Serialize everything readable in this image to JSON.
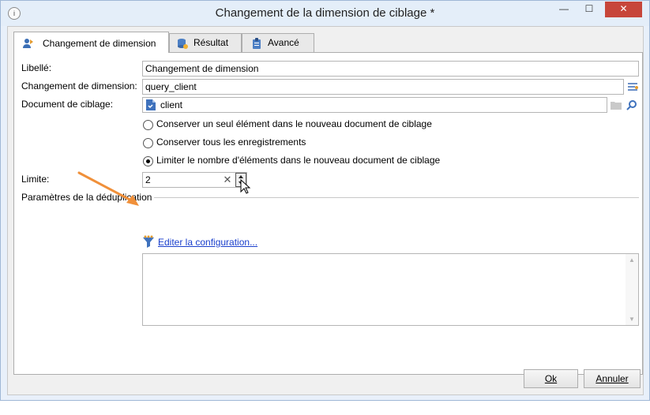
{
  "window": {
    "title": "Changement de la dimension de ciblage *",
    "app_icon": "i",
    "controls": {
      "minimize": "—",
      "maximize": "☐",
      "close": "✕"
    }
  },
  "tabs": [
    {
      "label": "Changement de dimension",
      "icon": "dimension-change-icon",
      "active": true
    },
    {
      "label": "Résultat",
      "icon": "result-icon",
      "active": false
    },
    {
      "label": "Avancé",
      "icon": "clipboard-icon",
      "active": false
    }
  ],
  "form": {
    "libelle_label": "Libellé:",
    "libelle_value": "Changement de dimension",
    "dimension_label": "Changement de dimension:",
    "dimension_value": "query_client",
    "document_label": "Document de ciblage:",
    "document_value": "client",
    "radios": [
      {
        "label": "Conserver un seul élément dans le nouveau document de ciblage",
        "checked": false
      },
      {
        "label": "Conserver tous les enregistrements",
        "checked": false
      },
      {
        "label": "Limiter le nombre d'éléments dans le nouveau document de ciblage",
        "checked": true
      }
    ],
    "limite_label": "Limite:",
    "limite_value": "2",
    "dedup_label": "Paramètres de la déduplication",
    "edit_config_link": "Editer la configuration..."
  },
  "buttons": {
    "ok": "Ok",
    "cancel": "Annuler"
  },
  "colors": {
    "accent_arrow": "#f0903a",
    "link": "#1a3fcc",
    "close_button": "#c7463a"
  }
}
